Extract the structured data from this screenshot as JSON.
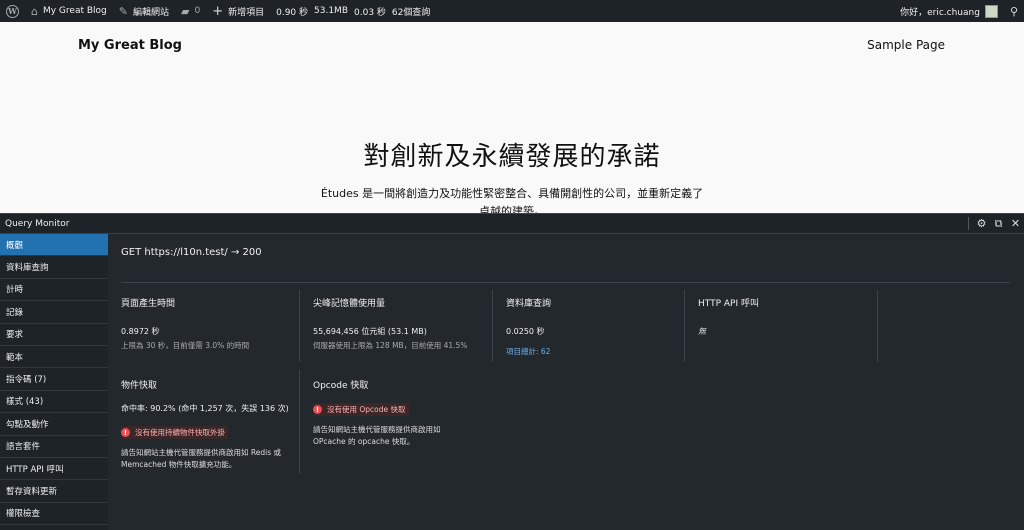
{
  "adminbar": {
    "site_name": "My Great Blog",
    "customize": "編輯網站",
    "comments_count": "0",
    "new_item": "新增項目",
    "qm_time": "0.90 秒",
    "qm_mem": "53.1MB",
    "qm_db": "0.03 秒",
    "qm_queries": "62個查詢",
    "greeting": "你好，eric.chuang"
  },
  "site": {
    "title": "My Great Blog",
    "nav_sample": "Sample Page",
    "hero_title": "對創新及永續發展的承諾",
    "hero_text": "Études 是一間將創造力及功能性緊密整合、具備開創性的公司，並重新定義了卓越的建築。"
  },
  "qm": {
    "title": "Query Monitor",
    "nav": [
      {
        "label": "概觀"
      },
      {
        "label": "資料庫查詢"
      },
      {
        "label": "計時"
      },
      {
        "label": "記錄"
      },
      {
        "label": "要求"
      },
      {
        "label": "範本"
      },
      {
        "label": "指令碼 (7)"
      },
      {
        "label": "樣式 (43)"
      },
      {
        "label": "勾點及動作"
      },
      {
        "label": "語言套件"
      },
      {
        "label": "HTTP API 呼叫"
      },
      {
        "label": "暫存資料更新"
      },
      {
        "label": "權限檢查"
      }
    ],
    "request": "GET https://l10n.test/ → 200",
    "page_time": {
      "heading": "頁面產生時間",
      "value": "0.8972 秒",
      "sub": "上限為 30 秒，目前僅需 3.0% 的時間"
    },
    "memory": {
      "heading": "尖峰記憶體使用量",
      "value": "55,694,456 位元組 (53.1 MB)",
      "sub": "伺服器使用上限為 128 MB，目前使用 41.5%"
    },
    "db": {
      "heading": "資料庫查詢",
      "value": "0.0250 秒",
      "link": "項目總計: 62"
    },
    "http": {
      "heading": "HTTP API 呼叫",
      "value": "無"
    },
    "object_cache": {
      "heading": "物件快取",
      "value": "命中率: 90.2% (命中 1,257 次，失誤 136 次)",
      "warning": "沒有使用持續物件快取外掛",
      "desc": "請告知網站主機代管服務提供商啟用如 Redis 或 Memcached 物件快取擴充功能。"
    },
    "opcode": {
      "heading": "Opcode 快取",
      "warning": "沒有使用 Opcode 快取",
      "desc": "請告知網站主機代管服務提供商啟用如 OPcache 的 opcache 快取。"
    }
  }
}
